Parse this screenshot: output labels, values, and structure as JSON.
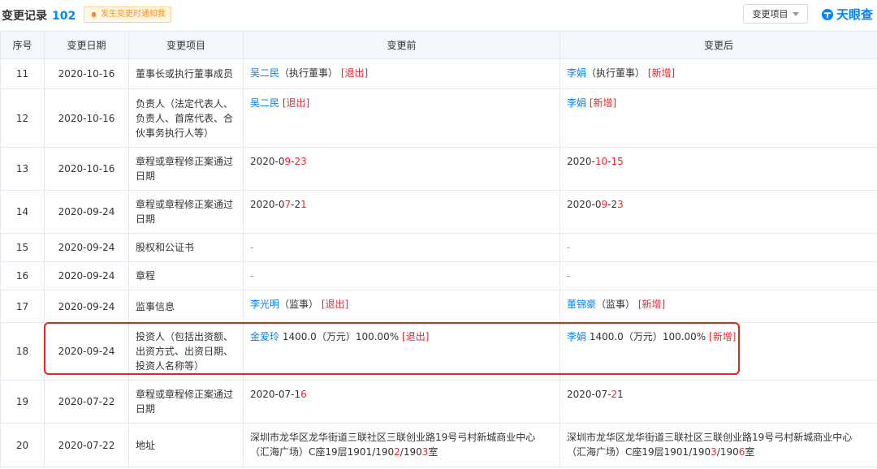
{
  "header": {
    "title": "变更记录",
    "count": "102",
    "notify_label": "发生变更时通知我",
    "filter_label": "变更项目",
    "logo_text": "天眼查"
  },
  "table": {
    "columns": [
      "序号",
      "变更日期",
      "变更项目",
      "变更前",
      "变更后"
    ],
    "rows": [
      {
        "no": "11",
        "date": "2020-10-16",
        "item": "董事长或执行董事成员",
        "before": [
          {
            "t": "吴二民",
            "k": "link"
          },
          {
            "t": "（执行董事）",
            "k": "text"
          },
          {
            "t": " [退出]",
            "k": "tag"
          }
        ],
        "after": [
          {
            "t": "李娟",
            "k": "link"
          },
          {
            "t": "（执行董事）",
            "k": "text"
          },
          {
            "t": " [新增]",
            "k": "tag"
          }
        ]
      },
      {
        "no": "12",
        "date": "2020-10-16",
        "item": "负责人（法定代表人、负责人、首席代表、合伙事务执行人等）",
        "before": [
          {
            "t": "吴二民",
            "k": "link"
          },
          {
            "t": " [退出]",
            "k": "tag"
          }
        ],
        "after": [
          {
            "t": "李娟",
            "k": "link"
          },
          {
            "t": " [新增]",
            "k": "tag"
          }
        ]
      },
      {
        "no": "13",
        "date": "2020-10-16",
        "item": "章程或章程修正案通过日期",
        "before": [
          {
            "t": "2020-0",
            "k": "text"
          },
          {
            "t": "9",
            "k": "red"
          },
          {
            "t": "-",
            "k": "text"
          },
          {
            "t": "23",
            "k": "red"
          }
        ],
        "after": [
          {
            "t": "2020-",
            "k": "text"
          },
          {
            "t": "10",
            "k": "red"
          },
          {
            "t": "-",
            "k": "text"
          },
          {
            "t": "15",
            "k": "red"
          }
        ]
      },
      {
        "no": "14",
        "date": "2020-09-24",
        "item": "章程或章程修正案通过日期",
        "before": [
          {
            "t": "2020-0",
            "k": "text"
          },
          {
            "t": "7",
            "k": "red"
          },
          {
            "t": "-2",
            "k": "text"
          },
          {
            "t": "1",
            "k": "red"
          }
        ],
        "after": [
          {
            "t": "2020-0",
            "k": "text"
          },
          {
            "t": "9",
            "k": "red"
          },
          {
            "t": "-2",
            "k": "text"
          },
          {
            "t": "3",
            "k": "red"
          }
        ]
      },
      {
        "no": "15",
        "date": "2020-09-24",
        "item": "股权和公证书",
        "before": [
          {
            "t": "-",
            "k": "dash"
          }
        ],
        "after": [
          {
            "t": "-",
            "k": "dash"
          }
        ]
      },
      {
        "no": "16",
        "date": "2020-09-24",
        "item": "章程",
        "before": [
          {
            "t": "-",
            "k": "dash"
          }
        ],
        "after": [
          {
            "t": "-",
            "k": "dash"
          }
        ]
      },
      {
        "no": "17",
        "date": "2020-09-24",
        "item": "监事信息",
        "before": [
          {
            "t": "李光明",
            "k": "link"
          },
          {
            "t": "（监事）",
            "k": "text"
          },
          {
            "t": " [退出]",
            "k": "tag"
          }
        ],
        "after": [
          {
            "t": "董锦豪",
            "k": "link"
          },
          {
            "t": "（监事）",
            "k": "text"
          },
          {
            "t": " [新增]",
            "k": "tag"
          }
        ]
      },
      {
        "no": "18",
        "date": "2020-09-24",
        "item": "投资人（包括出资额、出资方式、出资日期、投资人名称等）",
        "before": [
          {
            "t": "金爱玲",
            "k": "link"
          },
          {
            "t": " 1400.0（万元）100.00%",
            "k": "text"
          },
          {
            "t": " [退出]",
            "k": "tag"
          }
        ],
        "after": [
          {
            "t": "李娟",
            "k": "link"
          },
          {
            "t": " 1400.0（万元）100.00%",
            "k": "text"
          },
          {
            "t": " [新增]",
            "k": "tag"
          }
        ]
      },
      {
        "no": "19",
        "date": "2020-07-22",
        "item": "章程或章程修正案通过日期",
        "before": [
          {
            "t": "2020-07-1",
            "k": "text"
          },
          {
            "t": "6",
            "k": "red"
          }
        ],
        "after": [
          {
            "t": "2020-07-",
            "k": "text"
          },
          {
            "t": "2",
            "k": "red"
          },
          {
            "t": "1",
            "k": "text"
          }
        ]
      },
      {
        "no": "20",
        "date": "2020-07-22",
        "item": "地址",
        "before": [
          {
            "t": "深圳市龙华区龙华街道三联社区三联创业路19号弓村新城商业中心（汇海广场）C座19层1901/190",
            "k": "text"
          },
          {
            "t": "2",
            "k": "red"
          },
          {
            "t": "/190",
            "k": "text"
          },
          {
            "t": "3",
            "k": "red"
          },
          {
            "t": "室",
            "k": "text"
          }
        ],
        "after": [
          {
            "t": "深圳市龙华区龙华街道三联社区三联创业路19号弓村新城商业中心（汇海广场）C座19层1901/190",
            "k": "text"
          },
          {
            "t": "3",
            "k": "red"
          },
          {
            "t": "/190",
            "k": "text"
          },
          {
            "t": "6",
            "k": "red"
          },
          {
            "t": "室",
            "k": "text"
          }
        ]
      }
    ]
  },
  "colors": {
    "accent": "#0084ff",
    "tag": "#f5222d",
    "header_bg": "#f3f7fc",
    "highlight": "#e8231c"
  },
  "icons": {
    "notify": "bell-icon",
    "filter": "caret-down-icon",
    "logo": "logo-icon"
  }
}
